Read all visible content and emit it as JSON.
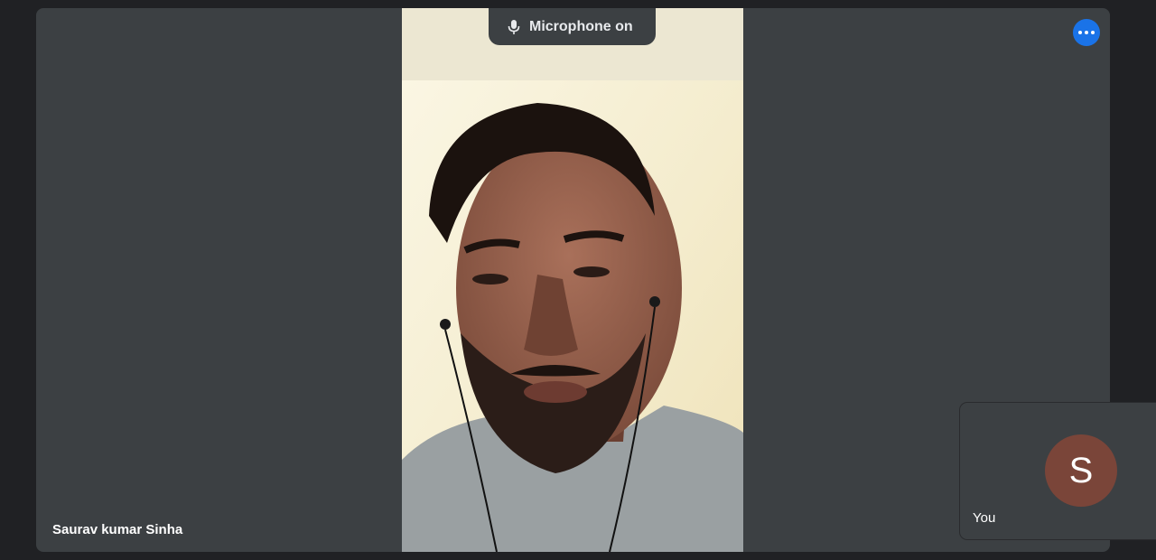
{
  "toast": {
    "text": "Microphone on",
    "icon": "microphone-icon"
  },
  "more_options": {
    "icon": "more-horizontal-icon",
    "color": "#1a73e8"
  },
  "main_participant": {
    "name": "Saurav kumar Sinha"
  },
  "self_view": {
    "avatar_initial": "S",
    "label": "You",
    "avatar_color": "#7a4539"
  }
}
